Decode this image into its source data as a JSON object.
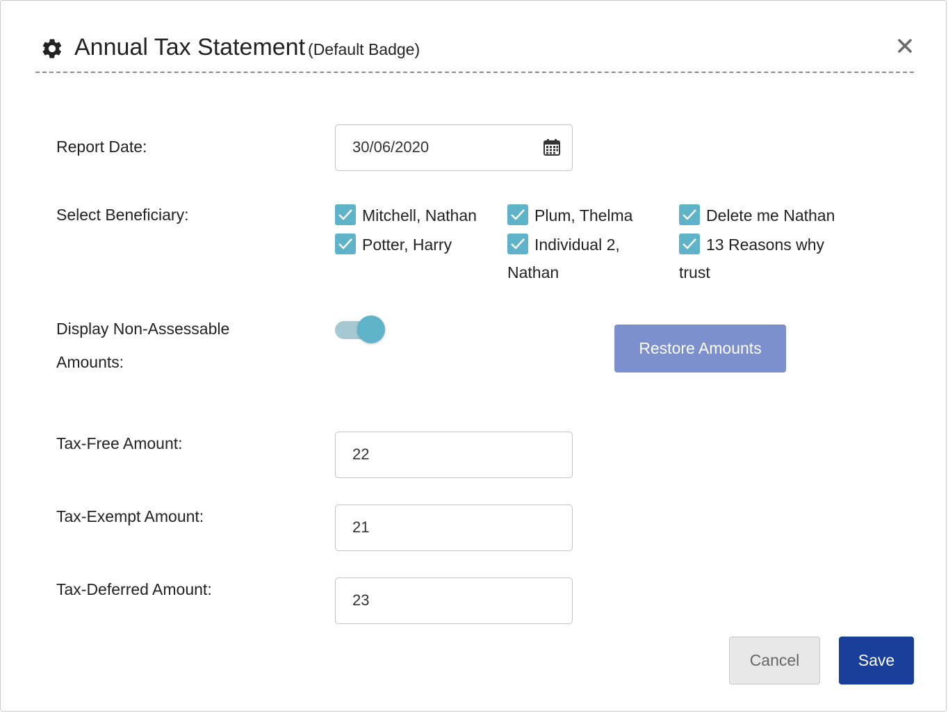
{
  "dialog": {
    "title": "Annual Tax Statement",
    "subtitle": "(Default Badge)",
    "settings_icon": "gear-icon",
    "close_icon": "close-icon"
  },
  "report_date": {
    "label": "Report Date:",
    "value": "30/06/2020",
    "icon": "calendar-icon"
  },
  "beneficiary": {
    "label": "Select Beneficiary:",
    "options": [
      {
        "label": "Mitchell, Nathan",
        "checked": true
      },
      {
        "label": "Plum, Thelma",
        "checked": true
      },
      {
        "label": "Delete me Nathan",
        "checked": true
      },
      {
        "label": "Potter, Harry",
        "checked": true
      },
      {
        "label_line1": "Individual 2,",
        "label_line2": "Nathan",
        "checked": true
      },
      {
        "label_line1": "13 Reasons why",
        "label_line2": "trust",
        "checked": true
      }
    ]
  },
  "non_assessable": {
    "label_line1": "Display Non-Assessable",
    "label_line2": "Amounts:",
    "enabled": true
  },
  "restore_button": "Restore Amounts",
  "tax_free": {
    "label": "Tax-Free Amount:",
    "value": "22"
  },
  "tax_exempt": {
    "label": "Tax-Exempt Amount:",
    "value": "21"
  },
  "tax_deferred": {
    "label": "Tax-Deferred Amount:",
    "value": "23"
  },
  "footer": {
    "cancel_label": "Cancel",
    "save_label": "Save"
  },
  "colors": {
    "checkbox": "#5fb3c8",
    "toggle": "#5fb3c8",
    "restore_button": "#7b90cc",
    "save_button": "#1a3f9b"
  }
}
